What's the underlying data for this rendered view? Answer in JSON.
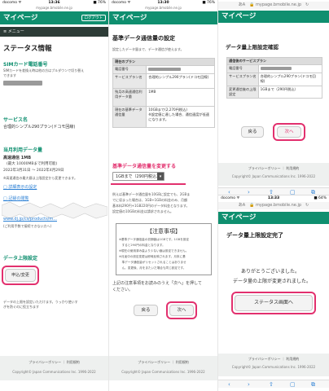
{
  "panel1": {
    "status": {
      "carrier": "docomo ᯤ",
      "time": "13:36",
      "battery": "■ 76%"
    },
    "url": "mypage.bmobile.ne.jp",
    "header": {
      "title": "マイページ",
      "logout": "ログアウト"
    },
    "menu_label": "≡ メニュー",
    "page_title": "ステータス情報",
    "sim_heading": "SIMカード電話番号",
    "sim_note_1": "SIMカードを差換え時は他の方はプルダウンで切り替え",
    "sim_note_2": "できます",
    "service_heading": "サービス名",
    "service_value": "合理的シンプル290プラン(ドコモ回線)",
    "usage_heading": "当月利用データ量",
    "speed_label": "高速通信 1MB",
    "speed_max": "(最大 10000MBまで利用可能)",
    "period": "2022年3月31日 ～ 2022年4月29日",
    "usage_note": "※高速通信の最大値は上限設定から変更できます。",
    "detail_link": "□ 詳細表示の設定",
    "mid_link": "□ 記録の閲覧",
    "dj_link": "www.dj.jp/cs/products/m...",
    "dj_note": "(ご利用手数で接続できない方へ)",
    "limit_heading": "データ上限設定",
    "apply_button": "申込/変更",
    "limit_note_1": "データの上限を設定いただけます。うっかり使いす",
    "limit_note_2": "ぎを防ぐのに役立ちます",
    "footer_links": "プライバシーポリシー ｜ 利用規約",
    "copyright": "Copyright© Japan Communications Inc. 1996-2022"
  },
  "panel2": {
    "status": {
      "carrier": "docomo ᯤ",
      "time": "13:30",
      "battery": "■ 76%"
    },
    "url": "mypage.bmobile.ne.jp",
    "header": {
      "title": "マイページ"
    },
    "page_title": "基準データ通信量の設定",
    "intro": "設定したデータ量まで、データ通信が使えます。",
    "table_head": "現在のプラン",
    "rows": [
      {
        "k": "電話番号",
        "v": ""
      },
      {
        "k": "サービスプラン名",
        "v": "合理的シンプル290プラン(ドコモ回線)"
      },
      {
        "k": "残月の高速通信利用データ量",
        "v": "1MB"
      },
      {
        "k": "現在の基準データ通信量",
        "v": "10GBまで(2,270円税込)\n※設定値に達した場合、通信速度が低速になります。"
      }
    ],
    "change_heading": "基準データ通信量を変更する",
    "select_value": "1GBまで（290円税込）",
    "select_arrow": "▾",
    "explain_1": "例えば基準データ通信量を10GBに設定でも、2GBま",
    "explain_2": "でに収まった場合は、1GB+1GBの料金のみ、月額",
    "explain_3": "基本料290円+1GB220円のデータ料金となります。",
    "explain_4": "設定値の10GBの料金は請求されません。",
    "notice_title": "【注意事項】",
    "notice_lines": [
      "※基準データ通信量の初期値は1GBです。1GBを設定",
      "　すると290円の料金となります。",
      "※現在の使用済み量より少ない値は設定できません。",
      "※月途中の設定変更は即時反映されます。月末に基",
      "　準データ通信量がリセットされることはありませ",
      "　ん。変更後、月をまたいだ場合も同じ設定です。"
    ],
    "confirm_1": "上記の注意事項をお読みのうえ「次へ」を押して",
    "confirm_2": "ください。",
    "back_button": "戻る",
    "next_button": "次へ",
    "footer_links": "プライバシーポリシー ｜ 利用規約",
    "copyright": "Copyright© Japan Communications Inc. 1996-2022"
  },
  "panel3": {
    "url_bar": "あA　🔒 mypage.bmobile.ne.jp　↻",
    "header": {
      "title": "マイページ"
    },
    "page_title": "データ量上限設定確認",
    "table_head": "通信後のサービスプラン",
    "rows": [
      {
        "k": "電話番号",
        "v": ""
      },
      {
        "k": "サービスプラン名",
        "v": "合理的シンプル290プラン(ドコモ回線)"
      },
      {
        "k": "変更通信後の上限設定",
        "v": "1GBまで（290円税込）"
      }
    ],
    "back_button": "戻る",
    "next_button": "次へ",
    "footer_links": "プライバシーポリシー ｜ 利用規約",
    "copyright": "Copyright© Japan Communications Inc. 1996-2022",
    "toolbar": [
      "‹",
      "›",
      "⇧",
      "▢",
      "⧉"
    ]
  },
  "panel4": {
    "status": {
      "carrier": "docomo ᯤ",
      "time": "13:33",
      "battery": "■ 64%"
    },
    "url_bar": "あA　🔒 mypage.bmobile.ne.jp　↻",
    "header": {
      "title": "マイページ"
    },
    "page_title": "データ量上限設定完了",
    "thanks": "ありがとうございました。",
    "changed": "データ量の上限が変更されました。",
    "status_button": "ステータス画面へ",
    "footer_links": "プライバシーポリシー ｜ 利用規約",
    "copyright": "Copyright© Japan Communications Inc. 1996-2022",
    "toolbar": [
      "‹",
      "›",
      "⇧",
      "▢",
      "⧉"
    ]
  },
  "colors": {
    "brand": "#0f8f6f",
    "highlight": "#e2306e",
    "link": "#2a7fd4"
  }
}
